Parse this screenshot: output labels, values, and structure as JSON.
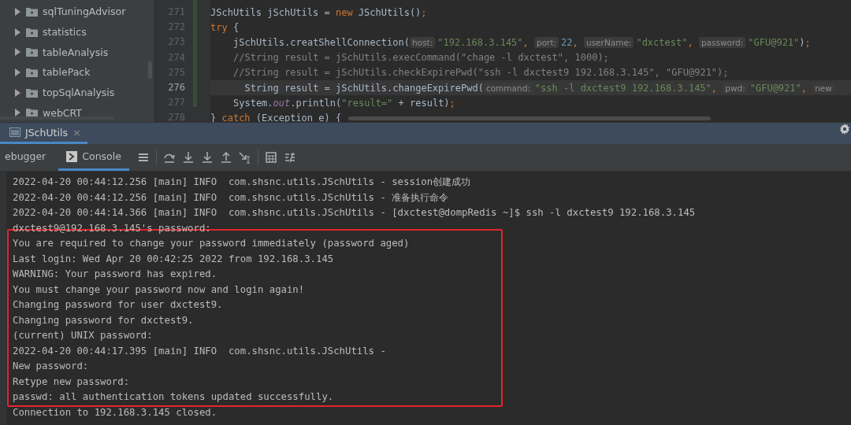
{
  "project_tree": {
    "items": [
      {
        "label": "sqlTuningAdvisor",
        "expanded": false
      },
      {
        "label": "statistics",
        "expanded": false
      },
      {
        "label": "tableAnalysis",
        "expanded": false
      },
      {
        "label": "tablePack",
        "expanded": false
      },
      {
        "label": "topSqlAnalysis",
        "expanded": false
      },
      {
        "label": "webCRT",
        "expanded": false
      }
    ]
  },
  "editor": {
    "lines": [
      {
        "number": "271",
        "current": false,
        "tokens": [
          {
            "kind": "plain",
            "text": "JSchUtils jSchUtils = "
          },
          {
            "kind": "keyword",
            "text": "new"
          },
          {
            "kind": "plain",
            "text": " JSchUtils()"
          },
          {
            "kind": "keyword",
            "text": ";"
          }
        ]
      },
      {
        "number": "272",
        "current": false,
        "tokens": [
          {
            "kind": "keyword",
            "text": "try"
          },
          {
            "kind": "plain",
            "text": " {"
          }
        ],
        "children": [
          {
            "number": "273",
            "current": false,
            "tokens": [
              {
                "kind": "plain",
                "text": "jSchUtils.creatShellConnection("
              },
              {
                "kind": "hint",
                "text": "host:"
              },
              {
                "kind": "string",
                "text": "\"192.168.3.145\""
              },
              {
                "kind": "keyword",
                "text": ", "
              },
              {
                "kind": "hint",
                "text": "port:"
              },
              {
                "kind": "number",
                "text": "22"
              },
              {
                "kind": "keyword",
                "text": ", "
              },
              {
                "kind": "hint",
                "text": "userName:"
              },
              {
                "kind": "string",
                "text": "\"dxctest\""
              },
              {
                "kind": "keyword",
                "text": ", "
              },
              {
                "kind": "hint",
                "text": "password:"
              },
              {
                "kind": "string",
                "text": "\"GFU@921\""
              },
              {
                "kind": "plain",
                "text": ")"
              },
              {
                "kind": "keyword",
                "text": ";"
              }
            ]
          },
          {
            "number": "274",
            "current": false,
            "tokens": [
              {
                "kind": "comment",
                "text": "//String result = jSchUtils.execCommand(\"chage -l dxctest\", 1000);"
              }
            ]
          },
          {
            "number": "275",
            "current": false,
            "tokens": [
              {
                "kind": "comment",
                "text": "//String result = jSchUtils.checkExpirePwd(\"ssh -l dxctest9 192.168.3.145\", \"GFU@921\");"
              }
            ]
          },
          {
            "number": "276",
            "current": true,
            "tokens": [
              {
                "kind": "plain",
                "text": "  String result = jSchUtils.changeExpirePwd("
              },
              {
                "kind": "hint",
                "text": "command:"
              },
              {
                "kind": "string",
                "text": "\"ssh -l dxctest9 192.168.3.145\""
              },
              {
                "kind": "keyword",
                "text": ", "
              },
              {
                "kind": "hint",
                "text": "pwd:"
              },
              {
                "kind": "string",
                "text": "\"GFU@921\""
              },
              {
                "kind": "keyword",
                "text": ", "
              },
              {
                "kind": "hint",
                "text": "new"
              }
            ]
          },
          {
            "number": "277",
            "current": false,
            "tokens": [
              {
                "kind": "plain",
                "text": "System."
              },
              {
                "kind": "field",
                "text": "out"
              },
              {
                "kind": "plain",
                "text": ".println("
              },
              {
                "kind": "string",
                "text": "\"result=\""
              },
              {
                "kind": "plain",
                "text": " + result)"
              },
              {
                "kind": "keyword",
                "text": ";"
              }
            ]
          }
        ]
      },
      {
        "number": "278",
        "current": false,
        "tokens": [
          {
            "kind": "plain",
            "text": "} "
          },
          {
            "kind": "keyword",
            "text": "catch"
          },
          {
            "kind": "plain",
            "text": " (Exception e) {"
          }
        ]
      }
    ]
  },
  "run_tab": {
    "label": "JSchUtils",
    "close": "×"
  },
  "console_tabs": [
    {
      "label": "ebugger",
      "selected": false
    },
    {
      "label": "Console",
      "selected": true
    }
  ],
  "console": {
    "blocks": [
      {
        "framed": false,
        "lines": [
          "2022-04-20 00:44:12.256 [main] INFO  com.shsnc.utils.JSchUtils - session创建成功",
          "2022-04-20 00:44:12.256 [main] INFO  com.shsnc.utils.JSchUtils - 准备执行命令",
          "2022-04-20 00:44:14.366 [main] INFO  com.shsnc.utils.JSchUtils - [dxctest@dompRedis ~]$ ssh -l dxctest9 192.168.3.145",
          "dxctest9@192.168.3.145's password:"
        ]
      },
      {
        "framed": true,
        "lines": [
          "You are required to change your password immediately (password aged)",
          "Last login: Wed Apr 20 00:42:25 2022 from 192.168.3.145",
          "WARNING: Your password has expired.",
          "You must change your password now and login again!",
          "Changing password for user dxctest9.",
          "Changing password for dxctest9.",
          "(current) UNIX password:",
          "2022-04-20 00:44:17.395 [main] INFO  com.shsnc.utils.JSchUtils -",
          "New password:",
          "Retype new password:",
          "passwd: all authentication tokens updated successfully."
        ]
      },
      {
        "framed": false,
        "lines": [
          "Connection to 192.168.3.145 closed."
        ]
      }
    ]
  }
}
